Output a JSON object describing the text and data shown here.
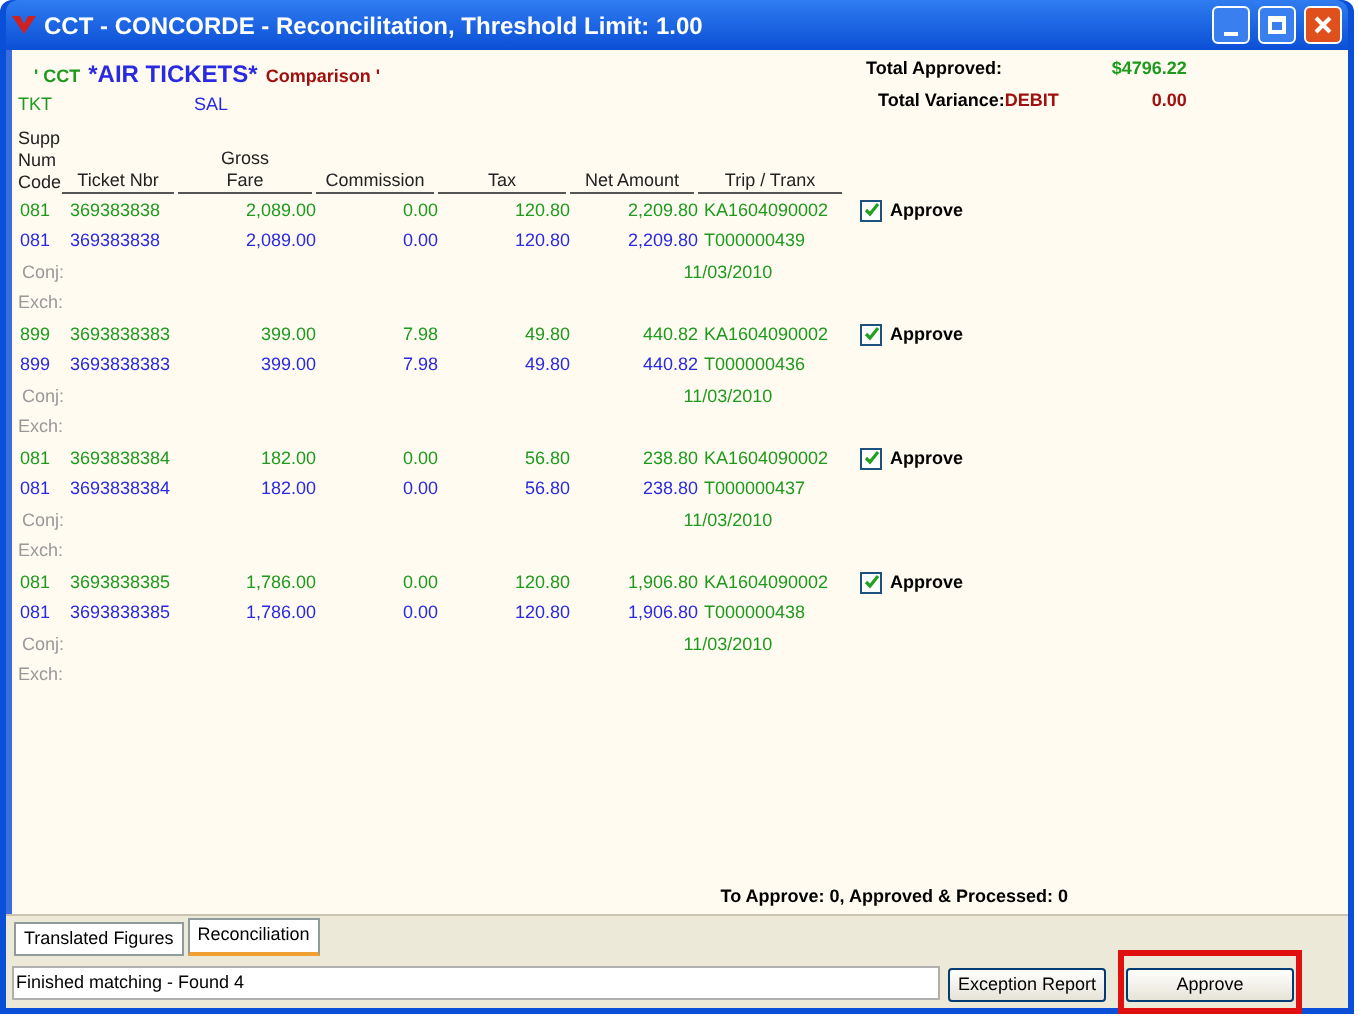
{
  "window": {
    "title": "CCT - CONCORDE - Reconcilitation, Threshold Limit: 1.00"
  },
  "header": {
    "source": "' CCT",
    "title": "*AIR TICKETS*",
    "comparison": "Comparison '",
    "tkt": "TKT",
    "sal": "SAL"
  },
  "totals": {
    "approved_label": "Total Approved:",
    "approved_value": "$4796.22",
    "variance_label": "Total Variance:",
    "variance_type": "DEBIT",
    "variance_value": "0.00"
  },
  "columns": [
    {
      "lines": [
        "Supp",
        "Num",
        "Code"
      ]
    },
    {
      "lines": [
        "Ticket Nbr"
      ]
    },
    {
      "lines": [
        "Gross",
        "Fare"
      ]
    },
    {
      "lines": [
        "Commission"
      ]
    },
    {
      "lines": [
        "Tax"
      ]
    },
    {
      "lines": [
        "Net Amount"
      ]
    },
    {
      "lines": [
        "Trip / Tranx"
      ]
    }
  ],
  "groups": [
    {
      "rows": [
        {
          "kind": "supplier",
          "cells": [
            "081",
            "369383838",
            "2,089.00",
            "0.00",
            "120.80",
            "2,209.80",
            "KA1604090002"
          ]
        },
        {
          "kind": "agency",
          "cells": [
            "081",
            "369383838",
            "2,089.00",
            "0.00",
            "120.80",
            "2,209.80",
            "T000000439"
          ]
        }
      ],
      "conj": "Conj:",
      "date": "11/03/2010",
      "exch": "Exch:",
      "approve": {
        "label": "Approve",
        "checked": true
      }
    },
    {
      "rows": [
        {
          "kind": "supplier",
          "cells": [
            "899",
            "3693838383",
            "399.00",
            "7.98",
            "49.80",
            "440.82",
            "KA1604090002"
          ]
        },
        {
          "kind": "agency",
          "cells": [
            "899",
            "3693838383",
            "399.00",
            "7.98",
            "49.80",
            "440.82",
            "T000000436"
          ]
        }
      ],
      "conj": "Conj:",
      "date": "11/03/2010",
      "exch": "Exch:",
      "approve": {
        "label": "Approve",
        "checked": true
      }
    },
    {
      "rows": [
        {
          "kind": "supplier",
          "cells": [
            "081",
            "3693838384",
            "182.00",
            "0.00",
            "56.80",
            "238.80",
            "KA1604090002"
          ]
        },
        {
          "kind": "agency",
          "cells": [
            "081",
            "3693838384",
            "182.00",
            "0.00",
            "56.80",
            "238.80",
            "T000000437"
          ]
        }
      ],
      "conj": "Conj:",
      "date": "11/03/2010",
      "exch": "Exch:",
      "approve": {
        "label": "Approve",
        "checked": true
      }
    },
    {
      "rows": [
        {
          "kind": "supplier",
          "cells": [
            "081",
            "3693838385",
            "1,786.00",
            "0.00",
            "120.80",
            "1,906.80",
            "KA1604090002"
          ]
        },
        {
          "kind": "agency",
          "cells": [
            "081",
            "3693838385",
            "1,786.00",
            "0.00",
            "120.80",
            "1,906.80",
            "T000000438"
          ]
        }
      ],
      "conj": "Conj:",
      "date": "11/03/2010",
      "exch": "Exch:",
      "approve": {
        "label": "Approve",
        "checked": true
      }
    }
  ],
  "summary": "To Approve: 0, Approved & Processed: 0",
  "tabs": [
    {
      "label": "Translated Figures",
      "selected": false
    },
    {
      "label": "Reconciliation",
      "selected": true
    }
  ],
  "status": {
    "value": "Finished matching - Found 4"
  },
  "buttons": [
    {
      "label": "Exception Report",
      "highlighted": false
    },
    {
      "label": "Approve",
      "highlighted": true
    }
  ]
}
